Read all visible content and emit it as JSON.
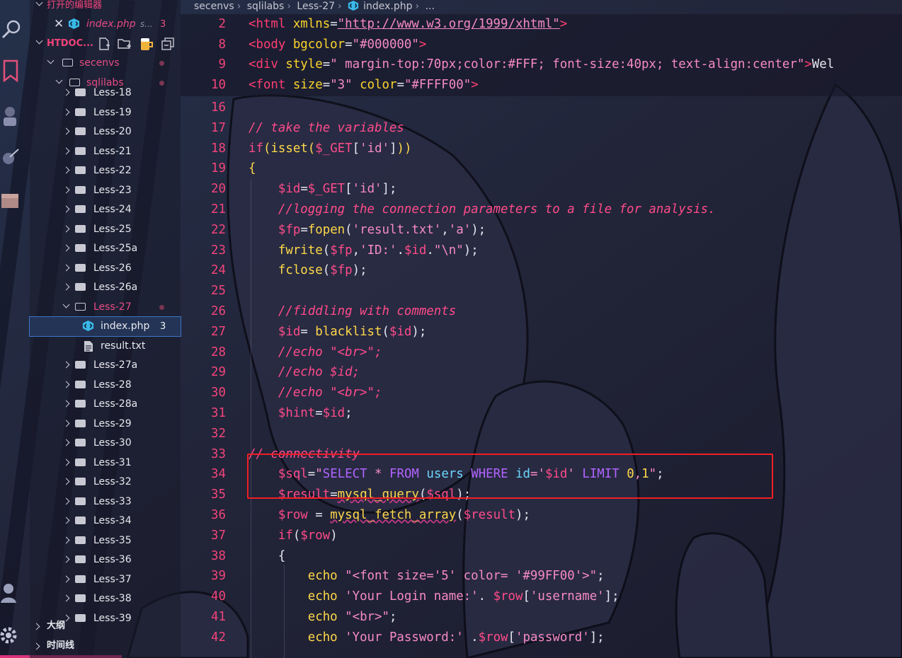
{
  "colors": {
    "accent": "#f1447a",
    "selection": "#243456",
    "highlight_box": "#f11e25"
  },
  "sidebar": {
    "open_editors_label": "打开的编辑器",
    "open_file": {
      "name": "index.php",
      "suffix": "s...",
      "problems": "3"
    },
    "workspace_label": "HTDOC...",
    "folders": {
      "secenvs": "secenvs",
      "sqlilabs": "sqlilabs"
    },
    "items": [
      {
        "label": "Less-18"
      },
      {
        "label": "Less-19"
      },
      {
        "label": "Less-20"
      },
      {
        "label": "Less-21"
      },
      {
        "label": "Less-22"
      },
      {
        "label": "Less-23"
      },
      {
        "label": "Less-24"
      },
      {
        "label": "Less-25"
      },
      {
        "label": "Less-25a"
      },
      {
        "label": "Less-26"
      },
      {
        "label": "Less-26a"
      },
      {
        "label": "Less-27"
      }
    ],
    "less27_files": [
      {
        "label": "index.php",
        "problems": "3"
      },
      {
        "label": "result.txt"
      }
    ],
    "items_after": [
      {
        "label": "Less-27a"
      },
      {
        "label": "Less-28"
      },
      {
        "label": "Less-28a"
      },
      {
        "label": "Less-29"
      },
      {
        "label": "Less-30"
      },
      {
        "label": "Less-31"
      },
      {
        "label": "Less-32"
      },
      {
        "label": "Less-33"
      },
      {
        "label": "Less-34"
      },
      {
        "label": "Less-35"
      },
      {
        "label": "Less-36"
      },
      {
        "label": "Less-37"
      },
      {
        "label": "Less-38"
      },
      {
        "label": "Less-39"
      }
    ],
    "outline_label": "大纲",
    "timeline_label": "时间线"
  },
  "breadcrumb": [
    "secenvs",
    "sqlilabs",
    "Less-27",
    "index.php",
    "..."
  ],
  "sticky_lines": [
    {
      "n": "2",
      "tokens": [
        [
          "tag",
          "<html "
        ],
        [
          "attr",
          "xmlns"
        ],
        [
          "punc",
          "="
        ],
        [
          "url",
          "\"http://www.w3.org/1999/xhtml\""
        ],
        [
          "tag",
          ">"
        ]
      ]
    },
    {
      "n": "8",
      "tokens": [
        [
          "tag",
          "<body "
        ],
        [
          "attr",
          "bgcolor"
        ],
        [
          "punc",
          "="
        ],
        [
          "str",
          "\"#000000\""
        ],
        [
          "tag",
          ">"
        ]
      ]
    },
    {
      "n": "9",
      "tokens": [
        [
          "tag",
          "<div "
        ],
        [
          "attr",
          "style"
        ],
        [
          "punc",
          "="
        ],
        [
          "str",
          "\" margin-top:70px;color:#FFF; font-size:40px; text-align:center\""
        ],
        [
          "tag",
          ">"
        ],
        [
          "txt",
          "Wel"
        ]
      ]
    },
    {
      "n": "10",
      "tokens": [
        [
          "tag",
          "<font "
        ],
        [
          "attr",
          "size"
        ],
        [
          "punc",
          "="
        ],
        [
          "str",
          "\"3\" "
        ],
        [
          "attr",
          "color"
        ],
        [
          "punc",
          "="
        ],
        [
          "str",
          "\"#FFFF00\""
        ],
        [
          "tag",
          ">"
        ]
      ]
    }
  ],
  "code_lines": [
    {
      "n": "16",
      "tokens": []
    },
    {
      "n": "17",
      "tokens": [
        [
          "cmt",
          "// take the variables"
        ]
      ]
    },
    {
      "n": "18",
      "tokens": [
        [
          "kw",
          "if"
        ],
        [
          "brk",
          "("
        ],
        [
          "fn",
          "isset"
        ],
        [
          "brk",
          "("
        ],
        [
          "var",
          "$_GET"
        ],
        [
          "punc",
          "["
        ],
        [
          "str",
          "'id'"
        ],
        [
          "punc",
          "]"
        ],
        [
          "brk",
          "))"
        ]
      ]
    },
    {
      "n": "19",
      "tokens": [
        [
          "brk",
          "{"
        ]
      ]
    },
    {
      "n": "20",
      "tokens": [
        [
          "txt",
          "    "
        ],
        [
          "var",
          "$id"
        ],
        [
          "punc",
          "="
        ],
        [
          "var",
          "$_GET"
        ],
        [
          "punc",
          "["
        ],
        [
          "str",
          "'id'"
        ],
        [
          "punc",
          "];"
        ]
      ]
    },
    {
      "n": "21",
      "tokens": [
        [
          "txt",
          "    "
        ],
        [
          "cmt",
          "//logging the connection parameters to a file for analysis."
        ]
      ]
    },
    {
      "n": "22",
      "tokens": [
        [
          "txt",
          "    "
        ],
        [
          "var",
          "$fp"
        ],
        [
          "punc",
          "="
        ],
        [
          "fn",
          "fopen"
        ],
        [
          "punc",
          "("
        ],
        [
          "str",
          "'result.txt'"
        ],
        [
          "punc",
          ","
        ],
        [
          "str",
          "'a'"
        ],
        [
          "punc",
          ");"
        ]
      ]
    },
    {
      "n": "23",
      "tokens": [
        [
          "txt",
          "    "
        ],
        [
          "fn",
          "fwrite"
        ],
        [
          "punc",
          "("
        ],
        [
          "var",
          "$fp"
        ],
        [
          "punc",
          ","
        ],
        [
          "str",
          "'ID:'"
        ],
        [
          "punc",
          "."
        ],
        [
          "var",
          "$id"
        ],
        [
          "punc",
          "."
        ],
        [
          "str",
          "\"\\n\""
        ],
        [
          "punc",
          ");"
        ]
      ]
    },
    {
      "n": "24",
      "tokens": [
        [
          "txt",
          "    "
        ],
        [
          "fn",
          "fclose"
        ],
        [
          "punc",
          "("
        ],
        [
          "var",
          "$fp"
        ],
        [
          "punc",
          ");"
        ]
      ]
    },
    {
      "n": "25",
      "tokens": []
    },
    {
      "n": "26",
      "tokens": [
        [
          "txt",
          "    "
        ],
        [
          "cmt",
          "//fiddling with comments"
        ]
      ]
    },
    {
      "n": "27",
      "tokens": [
        [
          "txt",
          "    "
        ],
        [
          "var",
          "$id"
        ],
        [
          "punc",
          "= "
        ],
        [
          "fn",
          "blacklist"
        ],
        [
          "punc",
          "("
        ],
        [
          "var",
          "$id"
        ],
        [
          "punc",
          ");"
        ]
      ]
    },
    {
      "n": "28",
      "tokens": [
        [
          "txt",
          "    "
        ],
        [
          "cmt",
          "//echo \"<br>\";"
        ]
      ]
    },
    {
      "n": "29",
      "tokens": [
        [
          "txt",
          "    "
        ],
        [
          "cmt",
          "//echo $id;"
        ]
      ]
    },
    {
      "n": "30",
      "tokens": [
        [
          "txt",
          "    "
        ],
        [
          "cmt",
          "//echo \"<br>\";"
        ]
      ]
    },
    {
      "n": "31",
      "tokens": [
        [
          "txt",
          "    "
        ],
        [
          "var",
          "$hint"
        ],
        [
          "punc",
          "="
        ],
        [
          "var",
          "$id"
        ],
        [
          "punc",
          ";"
        ]
      ]
    },
    {
      "n": "32",
      "tokens": []
    },
    {
      "n": "33",
      "tokens": [
        [
          "cmt",
          "// connectivity"
        ]
      ]
    },
    {
      "n": "34",
      "tokens": [
        [
          "txt",
          "    "
        ],
        [
          "var",
          "$sql"
        ],
        [
          "punc",
          "="
        ],
        [
          "str",
          "\""
        ],
        [
          "sqlk",
          "SELECT"
        ],
        [
          "str",
          " * "
        ],
        [
          "sqlk",
          "FROM"
        ],
        [
          "str",
          " "
        ],
        [
          "sqli",
          "users"
        ],
        [
          "str",
          " "
        ],
        [
          "sqlk",
          "WHERE"
        ],
        [
          "str",
          " "
        ],
        [
          "sqli",
          "id"
        ],
        [
          "str",
          "='"
        ],
        [
          "var",
          "$id"
        ],
        [
          "str",
          "' "
        ],
        [
          "sqlk",
          "LIMIT"
        ],
        [
          "str",
          " "
        ],
        [
          "num",
          "0"
        ],
        [
          "str",
          ","
        ],
        [
          "num",
          "1"
        ],
        [
          "str",
          "\""
        ],
        [
          "punc",
          ";"
        ]
      ]
    },
    {
      "n": "35",
      "tokens": [
        [
          "txt",
          "    "
        ],
        [
          "var",
          "$result"
        ],
        [
          "punc",
          "="
        ],
        [
          "fn",
          "mysql_query",
          "squig"
        ],
        [
          "punc",
          "("
        ],
        [
          "var",
          "$sql"
        ],
        [
          "punc",
          ");"
        ]
      ]
    },
    {
      "n": "36",
      "tokens": [
        [
          "txt",
          "    "
        ],
        [
          "var",
          "$row"
        ],
        [
          "punc",
          " = "
        ],
        [
          "fn",
          "mysql_fetch_array",
          "squig"
        ],
        [
          "punc",
          "("
        ],
        [
          "var",
          "$result"
        ],
        [
          "punc",
          ");"
        ]
      ]
    },
    {
      "n": "37",
      "tokens": [
        [
          "txt",
          "    "
        ],
        [
          "kw",
          "if"
        ],
        [
          "punc",
          "("
        ],
        [
          "var",
          "$row"
        ],
        [
          "punc",
          ")"
        ]
      ]
    },
    {
      "n": "38",
      "tokens": [
        [
          "txt",
          "    "
        ],
        [
          "punc",
          "{"
        ]
      ]
    },
    {
      "n": "39",
      "tokens": [
        [
          "txt",
          "        "
        ],
        [
          "fn",
          "echo"
        ],
        [
          "txt",
          " "
        ],
        [
          "str",
          "\"<font size='5' color= '#99FF00'>\""
        ],
        [
          "punc",
          ";"
        ]
      ]
    },
    {
      "n": "40",
      "tokens": [
        [
          "txt",
          "        "
        ],
        [
          "fn",
          "echo"
        ],
        [
          "txt",
          " "
        ],
        [
          "str",
          "'Your Login name:'"
        ],
        [
          "punc",
          ". "
        ],
        [
          "var",
          "$row"
        ],
        [
          "punc",
          "["
        ],
        [
          "str",
          "'username'"
        ],
        [
          "punc",
          "];"
        ]
      ]
    },
    {
      "n": "41",
      "tokens": [
        [
          "txt",
          "        "
        ],
        [
          "fn",
          "echo"
        ],
        [
          "txt",
          " "
        ],
        [
          "str",
          "\"<br>\""
        ],
        [
          "punc",
          ";"
        ]
      ]
    },
    {
      "n": "42",
      "tokens": [
        [
          "txt",
          "        "
        ],
        [
          "fn",
          "echo"
        ],
        [
          "txt",
          " "
        ],
        [
          "str",
          "'Your Password:'"
        ],
        [
          "punc",
          " ."
        ],
        [
          "var",
          "$row"
        ],
        [
          "punc",
          "["
        ],
        [
          "str",
          "'password'"
        ],
        [
          "punc",
          "];"
        ]
      ]
    }
  ]
}
